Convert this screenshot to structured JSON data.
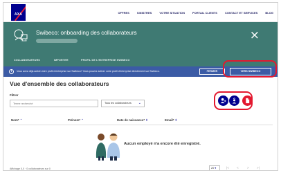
{
  "brand": {
    "logo_text": "AXA"
  },
  "topnav": {
    "links": [
      "OFFRES",
      "SINISTRES",
      "VOTRE SITUATION",
      "PORTAIL CLIENTS",
      "CONTACT ET SERVICES",
      "BLOG"
    ]
  },
  "header": {
    "title": "Swibeco: onboarding des collaborateurs",
    "close_glyph": "×"
  },
  "tabs": [
    "COLLABORATEURS",
    "IMPORTER",
    "PROFIL DE L'ENTREPRISE SWIBECO"
  ],
  "infobar": {
    "icon": "i",
    "text": "Vous avez déjà activé votre profil d'entreprise sur Swibeco? Vous pouvez activer votre profil d'entreprise directement sur Swibeco.",
    "close_label": "FERMER",
    "primary_label": "VERS SWIBECO"
  },
  "main": {
    "title": "Vue d'ensemble des collaborateurs",
    "filter_label": "Filtrer",
    "search_placeholder": "Terme recherché",
    "select_value": "Tous les collaborateurs"
  },
  "actions": [
    "add-user-icon",
    "upload-user-icon",
    "pdf-icon"
  ],
  "table": {
    "columns": [
      "Nom*",
      "Prénom*",
      "Date de naissance*",
      "Email*"
    ],
    "empty_text": "Aucun employé n'a encore été enregistré."
  },
  "footer": {
    "left_text": "Affichage 0-0 · 0 collaborateurs sur 0",
    "per_page": "20",
    "pager": [
      "|<",
      "<",
      ">",
      ">|"
    ]
  },
  "colors": {
    "brand_blue": "#00008f",
    "header_green": "#3f7a73",
    "info_blue": "#3b5ba5",
    "accent_red": "#e3182f"
  }
}
